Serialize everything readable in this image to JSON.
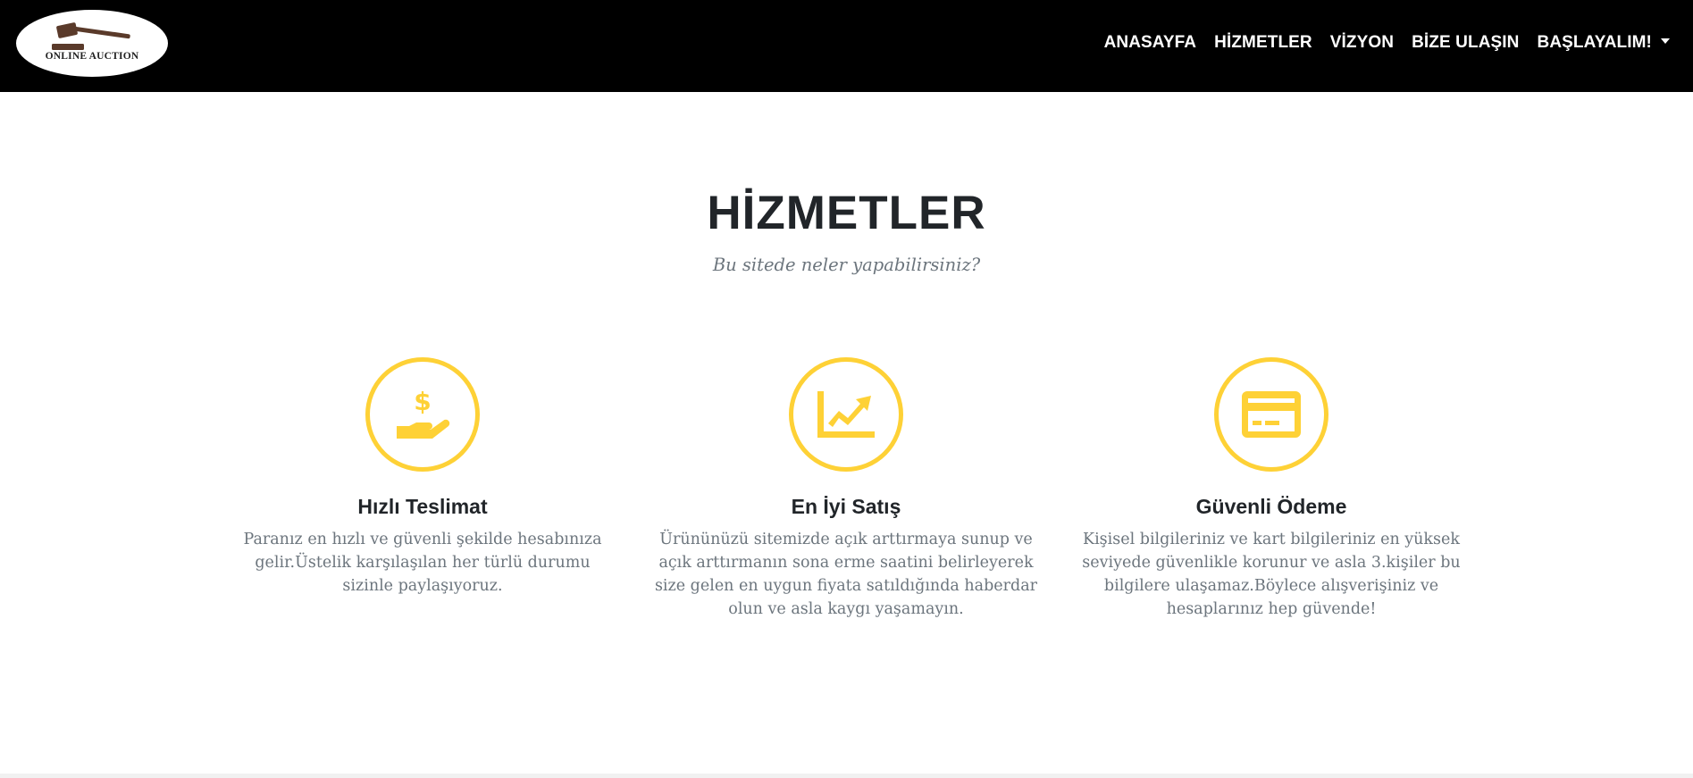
{
  "brand": {
    "logo_text": "ONLINE AUCTION",
    "logo_icon": "gavel-icon"
  },
  "nav": {
    "items": [
      {
        "label": "ANASAYFA"
      },
      {
        "label": "HİZMETLER"
      },
      {
        "label": "VİZYON"
      },
      {
        "label": "BİZE ULAŞIN"
      },
      {
        "label": "BAŞLAYALIM!",
        "dropdown": true
      }
    ]
  },
  "section": {
    "title": "HİZMETLER",
    "subtitle": "Bu sitede neler yapabilirsiniz?"
  },
  "services": [
    {
      "icon": "hand-holding-dollar-icon",
      "title": "Hızlı Teslimat",
      "text": "Paranız en hızlı ve güvenli şekilde hesabınıza gelir.Üstelik karşılaşılan her türlü durumu sizinle paylaşıyoruz."
    },
    {
      "icon": "chart-line-icon",
      "title": "En İyi Satış",
      "text": "Ürününüzü sitemizde açık arttırmaya sunup ve açık arttırmanın sona erme saatini belirleyerek size gelen en uygun fiyata satıldığında haberdar olun ve asla kaygı yaşamayın."
    },
    {
      "icon": "credit-card-icon",
      "title": "Güvenli Ödeme",
      "text": "Kişisel bilgileriniz ve kart bilgileriniz en yüksek seviyede güvenlikle korunur ve asla 3.kişiler bu bilgilere ulaşamaz.Böylece alışverişiniz ve hesaplarınız hep güvende!"
    }
  ],
  "colors": {
    "navbar_bg": "#000000",
    "accent": "#fed136",
    "heading": "#212529",
    "muted_text": "#6c757d"
  }
}
